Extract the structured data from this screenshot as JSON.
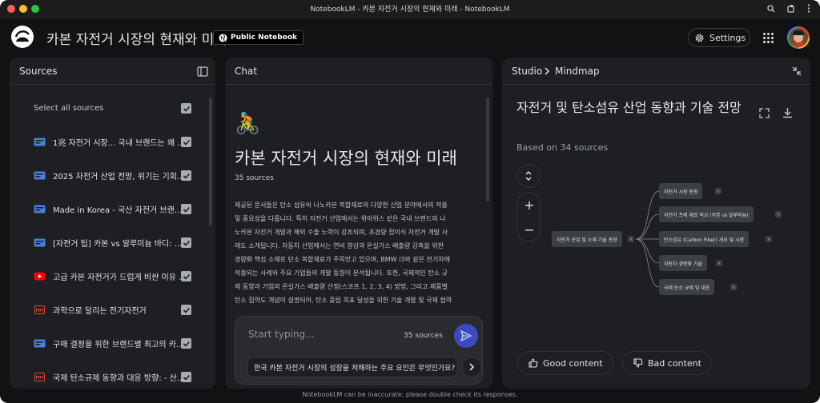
{
  "window": {
    "title": "NotebookLM - 카본 자전거 시장의 현재와 미래 - NotebookLM"
  },
  "header": {
    "notebook_title": "카본 자전거 시장의 현재와 미래",
    "public_badge": "Public Notebook",
    "settings_label": "Settings"
  },
  "sources": {
    "title": "Sources",
    "select_all": "Select all sources",
    "items": [
      {
        "label": "1兆 자전거 시장... 국내 브랜드는 왜 ...",
        "type": "doc"
      },
      {
        "label": "2025 자전거 산업 전망, 위기는 기회...",
        "type": "doc"
      },
      {
        "label": "Made in Korea - 국산 자전거 브랜...",
        "type": "doc"
      },
      {
        "label": "[자전거 팁] 카본 vs 알루미늄 바디: ...",
        "type": "doc"
      },
      {
        "label": "고급 카본 자전거가 드럽게 비싼 이유 ...",
        "type": "youtube"
      },
      {
        "label": "과학으로 달리는 전기자전거",
        "type": "pdf"
      },
      {
        "label": "구매 결정을 위한 브랜드별 최고의 카...",
        "type": "doc"
      },
      {
        "label": "국제 탄소규제 동향과 대응 방향: - 산...",
        "type": "pdf"
      }
    ]
  },
  "chat": {
    "title": "Chat",
    "emoji": "🚴",
    "notebook_title": "카본 자전거 시장의 현재와 미래",
    "source_count": "35 sources",
    "summary_lines": [
      "제공된 문서들은 탄소 섬유와 나노카본 복합재료의 다양한 산업 분야에서의 적용",
      "및 중요성을 다룹니다. 특히 자전거 산업에서는 위아위스 같은 국내 브랜드의 나",
      "노카본 자전거 개발과 해외 수출 노력이 강조되며, 초경량 접이식 자전거 개발 사",
      "례도 소개됩니다. 자동차 산업에서는 연비 향상과 온실가스 배출량 감축을 위한",
      "경량화 핵심 소재로 탄소 복합재료가 주목받고 있으며, BMW i3와 같은 전기차에",
      "적용되는 사례와 주요 기업들의 개발 동향이 분석됩니다. 또한, 국제적인 탄소 규",
      "제 동향과 기업의 온실가스 배출량 산정(스코프 1, 2, 3, 4) 방법, 그리고 제품별",
      "탄소 집약도 개념이 설명되어, 탄소 중립 목표 달성을 위한 기술 개발 및 국제 협력"
    ],
    "input_placeholder": "Start typing...",
    "input_sources": "35 sources",
    "suggestion": "한국 카본 자전거 시장의 성장을 저해하는 주요 요인은 무엇인가요?"
  },
  "studio": {
    "crumb_studio": "Studio",
    "crumb_mindmap": "Mindmap",
    "title": "자전거 및 탄소섬유 산업 동향과 기술 전망",
    "subtitle": "Based on 34 sources",
    "root_node": "자전거 산업 및 소재 기술 동향",
    "child_nodes": [
      "자전거 시장 동향",
      "자전거 프레 재료 비교 (카본 vs 알루미늄)",
      "탄소섬유 (Carbon Fiber) 개요 및 시장",
      "자동차 경량화 기술",
      "국제 탄소 규제 및 대응"
    ],
    "good_content": "Good content",
    "bad_content": "Bad content"
  },
  "footer": "NotebookLM can be inaccurate; please double check its responses.",
  "colors": {
    "background": "#111214",
    "panel": "#1e1f22",
    "accent_send": "#3b4bbf",
    "doc_icon": "#4a7fe0",
    "pdf_icon": "#e8453c",
    "youtube_icon": "#ff0000"
  }
}
